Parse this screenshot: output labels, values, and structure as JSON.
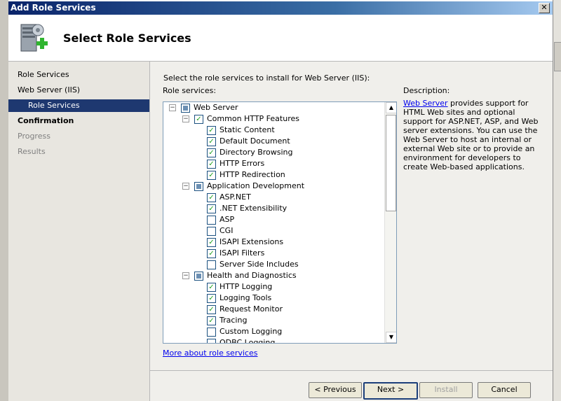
{
  "window": {
    "title": "Add Role Services",
    "close_glyph": "✕"
  },
  "header": {
    "title": "Select Role Services",
    "icon": "server-add-icon"
  },
  "nav": {
    "items": [
      {
        "label": "Role Services"
      },
      {
        "label": "Web Server (IIS)"
      },
      {
        "label": "Role Services"
      },
      {
        "label": "Confirmation"
      },
      {
        "label": "Progress"
      },
      {
        "label": "Results"
      }
    ]
  },
  "main": {
    "instruction": "Select the role services to install for Web Server (IIS):",
    "role_services_label": "Role services:",
    "description_label": "Description:",
    "description_link": "Web Server",
    "description_text": " provides support for HTML Web sites and optional support for ASP.NET, ASP, and Web server extensions. You can use the Web Server to host an internal or external Web site or to provide an environment for developers to create Web-based applications.",
    "more_link": "More about role services"
  },
  "tree": [
    {
      "label": "Web Server",
      "checked": false
    },
    {
      "label": "Common HTTP Features",
      "checked": true
    },
    {
      "label": "Static Content",
      "checked": true
    },
    {
      "label": "Default Document",
      "checked": true
    },
    {
      "label": "Directory Browsing",
      "checked": true
    },
    {
      "label": "HTTP Errors",
      "checked": true
    },
    {
      "label": "HTTP Redirection",
      "checked": true
    },
    {
      "label": "Application Development",
      "checked": false
    },
    {
      "label": "ASP.NET",
      "checked": true
    },
    {
      "label": ".NET Extensibility",
      "checked": true
    },
    {
      "label": "ASP",
      "checked": false
    },
    {
      "label": "CGI",
      "checked": false
    },
    {
      "label": "ISAPI Extensions",
      "checked": true
    },
    {
      "label": "ISAPI Filters",
      "checked": true
    },
    {
      "label": "Server Side Includes",
      "checked": false
    },
    {
      "label": "Health and Diagnostics",
      "checked": false
    },
    {
      "label": "HTTP Logging",
      "checked": true
    },
    {
      "label": "Logging Tools",
      "checked": true
    },
    {
      "label": "Request Monitor",
      "checked": true
    },
    {
      "label": "Tracing",
      "checked": true
    },
    {
      "label": "Custom Logging",
      "checked": false
    },
    {
      "label": "ODBC Logging",
      "checked": false
    }
  ],
  "buttons": {
    "previous": "< Previous",
    "next": "Next >",
    "install": "Install",
    "cancel": "Cancel"
  },
  "scroll_arrows": {
    "up": "▲",
    "down": "▼"
  },
  "tree_glyphs": {
    "collapse": "−",
    "check": "✓"
  }
}
